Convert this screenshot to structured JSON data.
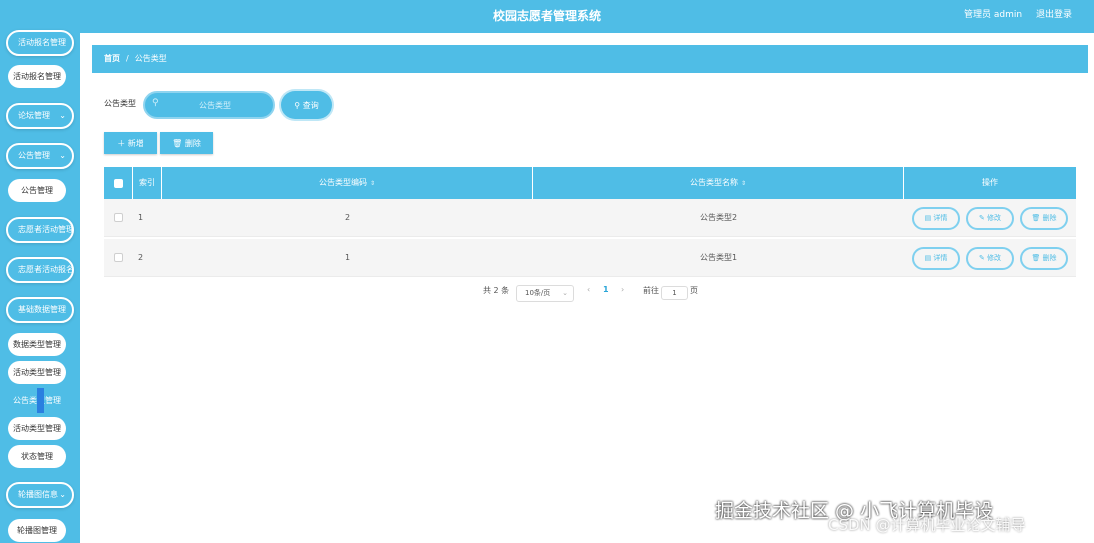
{
  "header": {
    "title": "校园志愿者管理系统",
    "user_label": "管理员 admin",
    "logout_label": "退出登录"
  },
  "sidebar": {
    "groups": [
      {
        "label": "活动报名管理"
      },
      {
        "label": "论坛管理"
      },
      {
        "label": "公告管理"
      },
      {
        "label": "志愿者活动管理"
      },
      {
        "label": "志愿者活动报名管理"
      },
      {
        "label": "基础数据管理"
      },
      {
        "label": "轮播图信息"
      }
    ],
    "items": [
      {
        "label": "活动报名管理"
      },
      {
        "label": "公告管理"
      },
      {
        "label": "数据类型管理"
      },
      {
        "label": "活动类型管理"
      },
      {
        "label": "公告类型管理"
      },
      {
        "label": "活动类型管理"
      },
      {
        "label": "状态管理"
      },
      {
        "label": "轮播图管理"
      }
    ]
  },
  "breadcrumb": {
    "home": "首页",
    "separator": "/",
    "current": "公告类型"
  },
  "search": {
    "label": "公告类型",
    "placeholder": "公告类型",
    "button_label": "查询"
  },
  "toolbar": {
    "add_label": "新增",
    "delete_label": "删除"
  },
  "table": {
    "columns": {
      "index": "索引",
      "code": "公告类型编码",
      "name": "公告类型名称",
      "actions": "操作"
    },
    "rows": [
      {
        "index": "1",
        "code": "2",
        "name": "公告类型2"
      },
      {
        "index": "2",
        "code": "1",
        "name": "公告类型1"
      }
    ],
    "row_actions": {
      "detail": "详情",
      "edit": "修改",
      "delete": "删除"
    }
  },
  "pagination": {
    "total": "共 2 条",
    "page_size": "10条/页",
    "prev": "‹",
    "current_page": "1",
    "next": "›",
    "goto_label": "前往",
    "goto_value": "1",
    "page_unit": "页"
  },
  "watermark": {
    "line1": "掘金技术社区 @ 小飞计算机毕设",
    "line2": "CSDN @计算机毕业论文辅导"
  },
  "colors": {
    "accent": "#4fbde6",
    "marker": "#2a7fe0"
  }
}
